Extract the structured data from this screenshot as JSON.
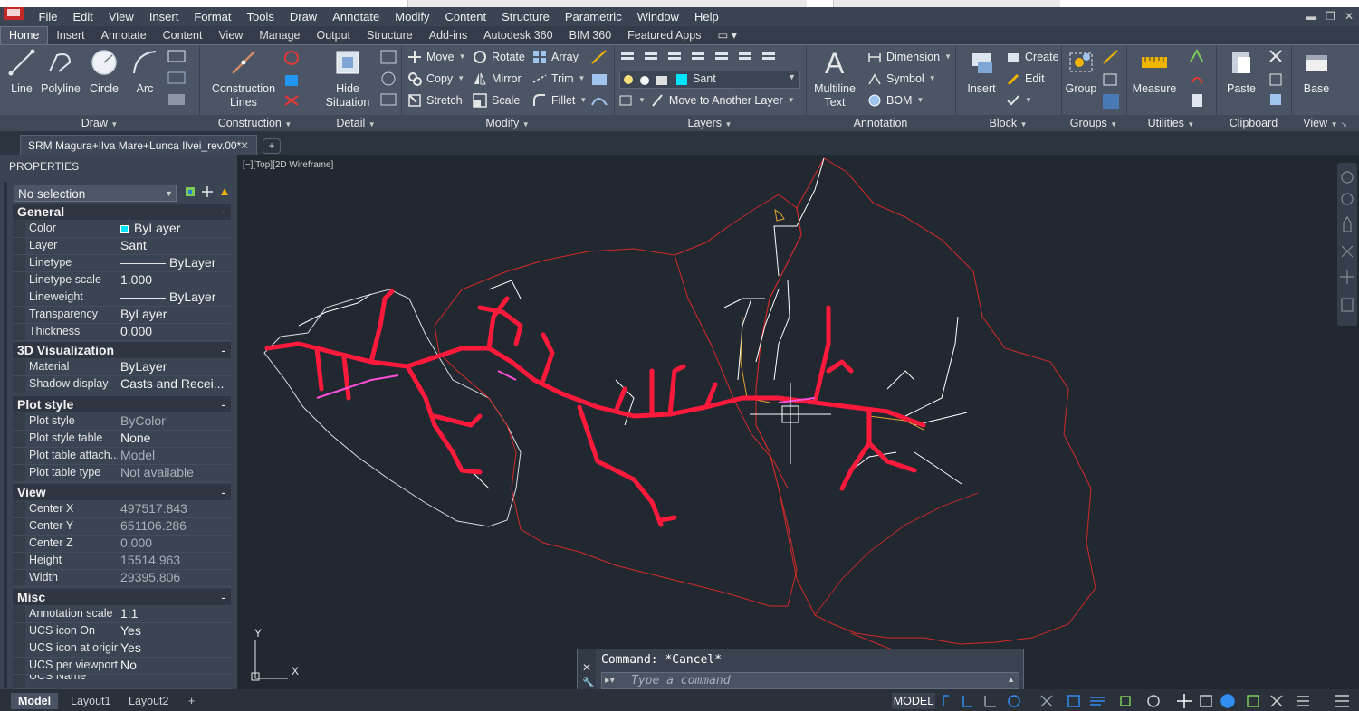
{
  "menu": [
    "File",
    "Edit",
    "View",
    "Insert",
    "Format",
    "Tools",
    "Draw",
    "Annotate",
    "Modify",
    "Content",
    "Structure",
    "Parametric",
    "Window",
    "Help"
  ],
  "ribbon_tabs": [
    "Home",
    "Insert",
    "Annotate",
    "Content",
    "View",
    "Manage",
    "Output",
    "Structure",
    "Add-ins",
    "Autodesk 360",
    "BIM 360",
    "Featured Apps"
  ],
  "ribbon": {
    "draw": {
      "title": "Draw",
      "line": "Line",
      "polyline": "Polyline",
      "circle": "Circle",
      "arc": "Arc"
    },
    "construction": {
      "title": "Construction",
      "lines1": "Construction",
      "lines2": "Lines"
    },
    "detail": {
      "title": "Detail",
      "hide1": "Hide",
      "hide2": "Situation"
    },
    "modify": {
      "title": "Modify",
      "move": "Move",
      "rotate": "Rotate",
      "array": "Array",
      "copy": "Copy",
      "mirror": "Mirror",
      "trim": "Trim",
      "stretch": "Stretch",
      "scale": "Scale",
      "fillet": "Fillet"
    },
    "layers": {
      "title": "Layers",
      "current_layer": "Sant",
      "move_to_layer": "Move to Another Layer",
      "layer_color": "#00e5ff"
    },
    "annotation": {
      "title": "Annotation",
      "mtext1": "Multiline",
      "mtext2": "Text",
      "dimension": "Dimension",
      "symbol": "Symbol",
      "bom": "BOM"
    },
    "block": {
      "title": "Block",
      "insert": "Insert",
      "create": "Create",
      "edit": "Edit"
    },
    "groups": {
      "title": "Groups",
      "group": "Group"
    },
    "utilities": {
      "title": "Utilities",
      "measure": "Measure"
    },
    "clipboard": {
      "title": "Clipboard",
      "paste": "Paste"
    },
    "view": {
      "title": "View",
      "base": "Base"
    }
  },
  "document_tab": "SRM Magura+Ilva Mare+Lunca Ilvei_rev.00*",
  "properties": {
    "header": "PROPERTIES",
    "selection": "No selection",
    "sections": {
      "general": {
        "title": "General",
        "rows": [
          {
            "label": "Color",
            "value": "ByLayer"
          },
          {
            "label": "Layer",
            "value": "Sant"
          },
          {
            "label": "Linetype",
            "value": "ByLayer"
          },
          {
            "label": "Linetype scale",
            "value": "1.000"
          },
          {
            "label": "Lineweight",
            "value": "ByLayer"
          },
          {
            "label": "Transparency",
            "value": "ByLayer"
          },
          {
            "label": "Thickness",
            "value": "0.000"
          }
        ]
      },
      "viz": {
        "title": "3D Visualization",
        "rows": [
          {
            "label": "Material",
            "value": "ByLayer"
          },
          {
            "label": "Shadow display",
            "value": "Casts  and  Recei..."
          }
        ]
      },
      "plot": {
        "title": "Plot style",
        "rows": [
          {
            "label": "Plot style",
            "value": "ByColor"
          },
          {
            "label": "Plot style table",
            "value": "None"
          },
          {
            "label": "Plot table attach...",
            "value": "Model"
          },
          {
            "label": "Plot table type",
            "value": "Not available"
          }
        ]
      },
      "view": {
        "title": "View",
        "rows": [
          {
            "label": "Center X",
            "value": "497517.843"
          },
          {
            "label": "Center Y",
            "value": "651106.286"
          },
          {
            "label": "Center Z",
            "value": "0.000"
          },
          {
            "label": "Height",
            "value": "15514.963"
          },
          {
            "label": "Width",
            "value": "29395.806"
          }
        ]
      },
      "misc": {
        "title": "Misc",
        "rows": [
          {
            "label": "Annotation scale",
            "value": "1:1"
          },
          {
            "label": "UCS icon On",
            "value": "Yes"
          },
          {
            "label": "UCS icon at origin",
            "value": "Yes"
          },
          {
            "label": "UCS per viewport",
            "value": "No"
          },
          {
            "label": "UCS Name",
            "value": ""
          }
        ]
      }
    }
  },
  "viewport_label": "[−][Top][2D Wireframe]",
  "ucs": {
    "x": "X",
    "y": "Y"
  },
  "command": {
    "last": "Command: *Cancel*",
    "placeholder": "Type a command"
  },
  "layout_tabs": [
    "Model",
    "Layout1",
    "Layout2"
  ],
  "status": {
    "mode": "MODEL"
  }
}
